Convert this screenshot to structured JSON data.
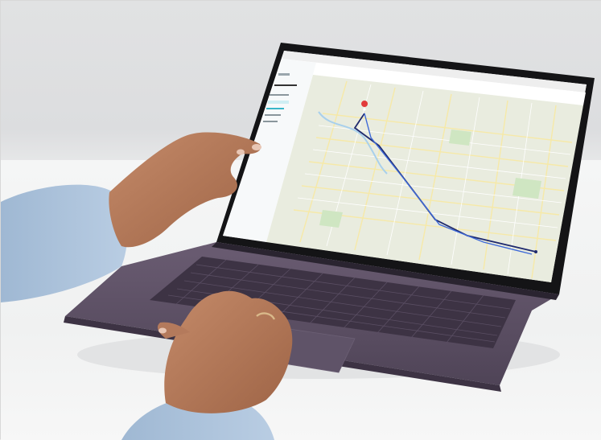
{
  "scene": {
    "subject": "laptop-on-desk",
    "colors": {
      "laptop_body": "#5a4e63",
      "keys": "#3d3344",
      "screen_bezel": "#141416",
      "map_base": "#e9ecdf",
      "route_dark": "#1f2a6e",
      "route_light": "#3f6ad8",
      "accent_teal": "#38b6c9",
      "sleeve": "#a9c2dc",
      "skin": "#b47a5c"
    }
  }
}
